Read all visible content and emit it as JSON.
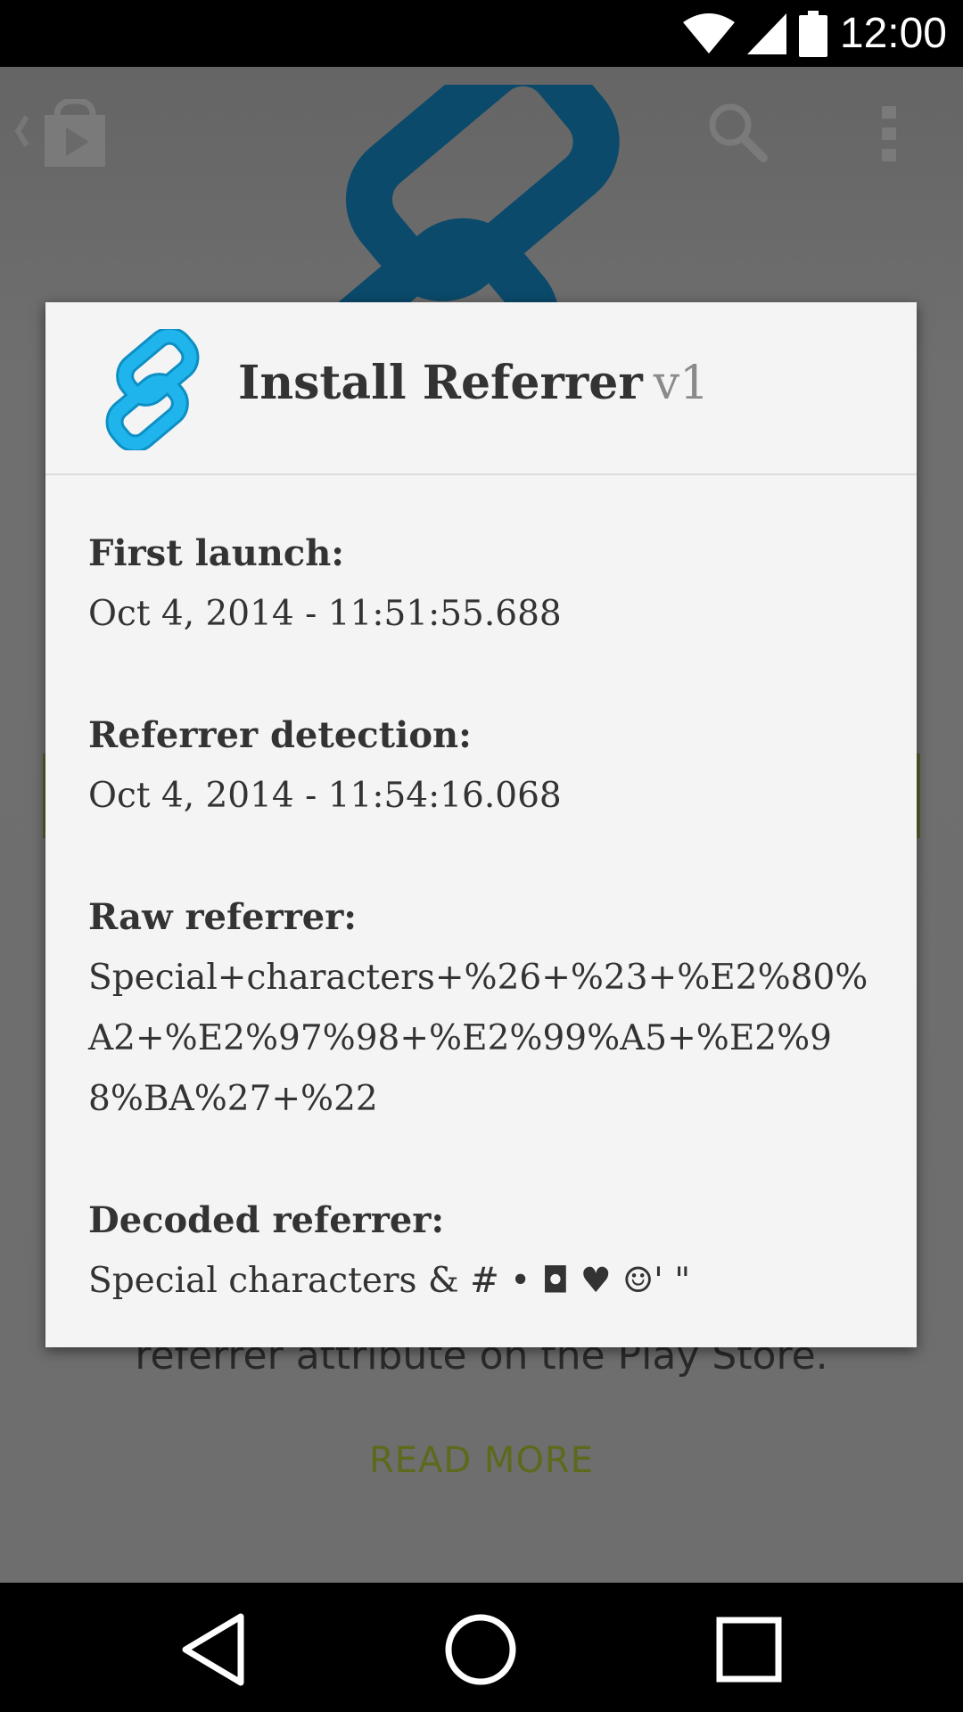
{
  "status_bar": {
    "time": "12:00"
  },
  "background": {
    "body_text": "referrer attribute on the Play Store.",
    "read_more": "READ MORE"
  },
  "dialog": {
    "title": "Install Referrer",
    "version": "v1",
    "fields": [
      {
        "label": "First launch:",
        "value": "Oct 4, 2014 - 11:51:55.688"
      },
      {
        "label": "Referrer detection:",
        "value": "Oct 4, 2014 - 11:54:16.068"
      },
      {
        "label": "Raw referrer:",
        "value": "Special+characters+%26+%23+%E2%80%A2+%E2%97%98+%E2%99%A5+%E2%98%BA%27+%22"
      },
      {
        "label": "Decoded referrer:",
        "value": "Special characters & # • ◘ ♥ ☺' \""
      }
    ]
  },
  "icons": {
    "app_icon": "link-icon",
    "store": "play-store-icon",
    "search": "search-icon",
    "overflow": "overflow-menu-icon",
    "wifi": "wifi-icon",
    "signal": "signal-icon",
    "battery": "battery-icon",
    "back": "back-icon",
    "home": "home-icon",
    "recents": "recents-icon"
  },
  "colors": {
    "link_icon": "#1fb5ec",
    "hero_link": "#0b4a6b",
    "read_more": "#5c6a1c"
  }
}
